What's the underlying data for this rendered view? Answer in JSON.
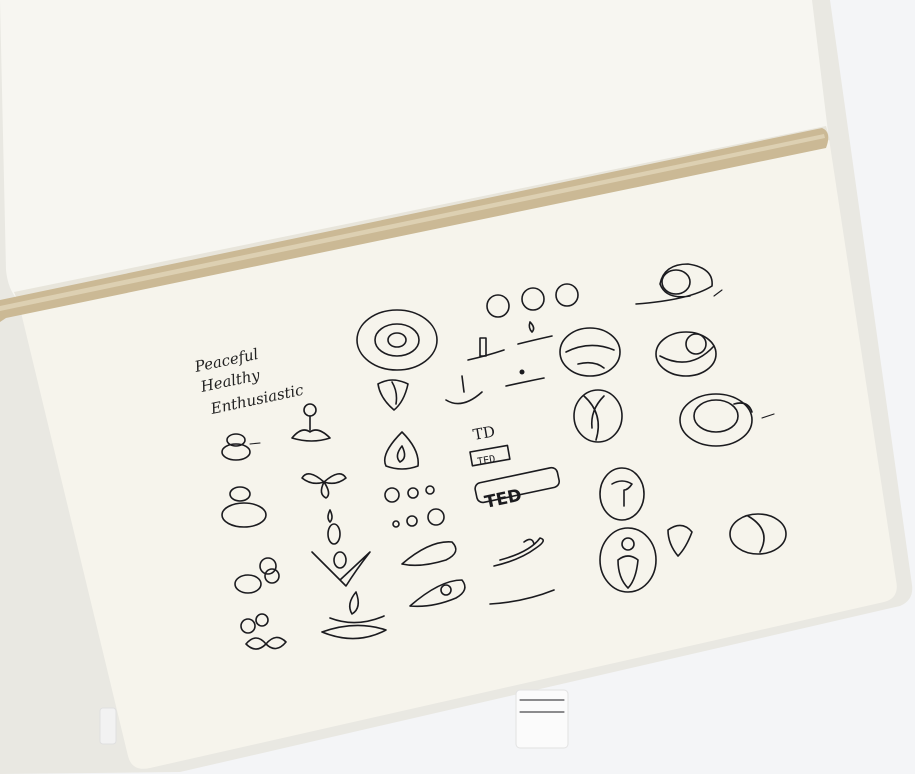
{
  "notebook": {
    "handwritten_words": [
      "Peaceful",
      "Healthy",
      "Enthusiastic"
    ],
    "sketch_labels": [
      "TD",
      "TED",
      "TED"
    ]
  },
  "colors": {
    "background": "#f4f5f7",
    "paper": "#f6f4ec",
    "ribbon": "#cbb995",
    "ink": "#1b1b1f"
  }
}
